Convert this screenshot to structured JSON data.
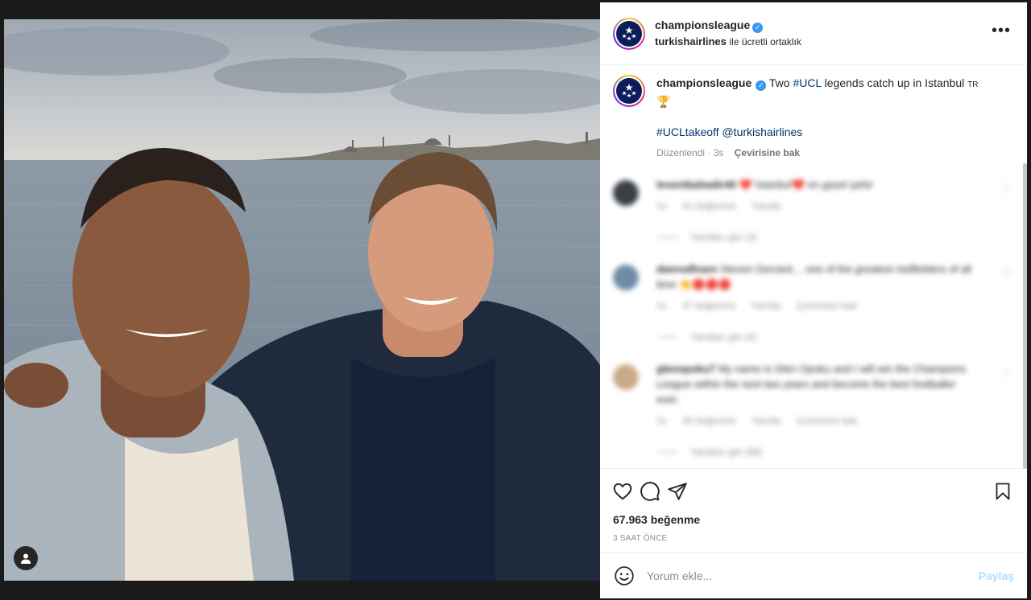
{
  "post": {
    "username": "championsleague",
    "partner": "turkishairlines",
    "partner_suffix": "ile ücretli ortaklık",
    "more_icon": "more-horizontal-icon"
  },
  "caption": {
    "username": "championsleague",
    "text_1": "Two ",
    "hashtag_ucl": "#UCL",
    "text_2": " legends catch up in Istanbul ",
    "flag": "TR",
    "trophy": "🏆",
    "hashtag_takeoff": "#UCLtakeoff",
    "mention": "@turkishairlines",
    "edited": "Düzenlendi · 3s",
    "translate": "Çevirisine bak"
  },
  "comments": [
    {
      "username": "leventbahadir40",
      "text": "❤️ İstanbul❤️  en güzel şehir",
      "time": "1s",
      "likes": "41 beğenme",
      "reply": "Yanıtla",
      "translate": "",
      "replies": "Yanıtları gör (3)",
      "avatar_color": "#3a3f45"
    },
    {
      "username": "danrodfvarn",
      "text": "Steven Gerrard… one of the greatest midfielders of all time 👏🔴🔴🔴",
      "time": "1s",
      "likes": "47 beğenme",
      "reply": "Yanıtla",
      "translate": "Çevirisine bak",
      "replies": "Yanıtları gör (4)",
      "avatar_color": "#6f8ba8"
    },
    {
      "username": "glenopoku7",
      "text": "My name is Glen Opoku and I will win the Champions League within the next two years and become the best footballer ever.",
      "time": "1s",
      "likes": "30 beğenme",
      "reply": "Yanıtla",
      "translate": "Çevirisine bak",
      "replies": "Yanıtları gör (98)",
      "avatar_color": "#c9a98a"
    }
  ],
  "actions": {
    "like_icon": "heart-icon",
    "comment_icon": "comment-icon",
    "share_icon": "send-icon",
    "save_icon": "bookmark-icon"
  },
  "likes": "67.963 beğenme",
  "time_ago": "3 SAAT ÖNCE",
  "add_comment": {
    "placeholder": "Yorum ekle...",
    "post_label": "Paylaş",
    "emoji_icon": "emoji-icon"
  },
  "colors": {
    "link": "#00376b",
    "verified": "#3897f0",
    "post_button": "#b2dffc"
  }
}
